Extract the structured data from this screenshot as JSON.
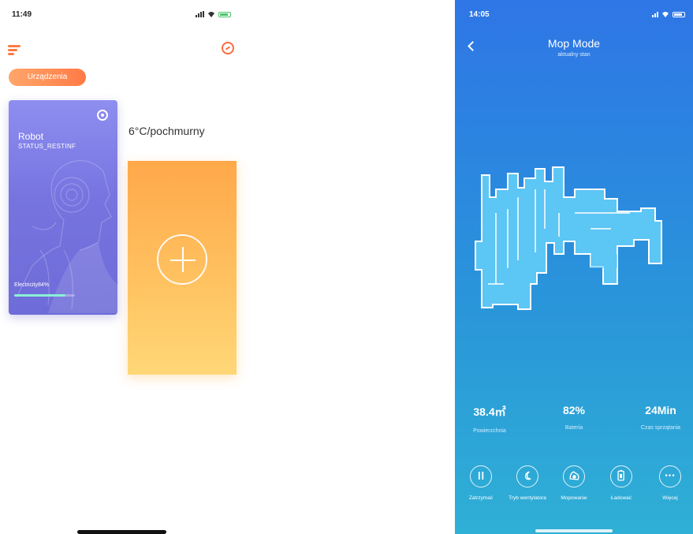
{
  "left_screen": {
    "status_time": "11:49",
    "device_chip": "Urządzenia",
    "robot_card": {
      "name": "Robot",
      "status": "STATUS_RESTINF",
      "electricity": "Electricity84%",
      "electricity_level": 0.84
    },
    "weather": "6°C/pochmurny",
    "colors": {
      "accent": "#ff7a45",
      "card_purple": "#7774e0",
      "add_card": "#ffbf5e"
    }
  },
  "right_screen": {
    "status_time": "14:05",
    "title": "Mop Mode",
    "subtitle": "aktualny stan",
    "stats": [
      {
        "value": "38.4㎡",
        "label": "Powierzchnia"
      },
      {
        "value": "82%",
        "label": "Bateria"
      },
      {
        "value": "24Min",
        "label": "Czas sprzątania"
      }
    ],
    "actions": [
      {
        "icon": "pause-icon",
        "label": "Zatrzymać"
      },
      {
        "icon": "fan-mode-icon",
        "label": "Tryb wentylatora"
      },
      {
        "icon": "mop-icon",
        "label": "Mopowanie"
      },
      {
        "icon": "charge-icon",
        "label": "Ładować"
      },
      {
        "icon": "more-icon",
        "label": "Więcej"
      }
    ],
    "colors": {
      "background_top": "#2f76e6",
      "background_bottom": "#2fb0d6",
      "map": "#5cc6f5"
    }
  }
}
